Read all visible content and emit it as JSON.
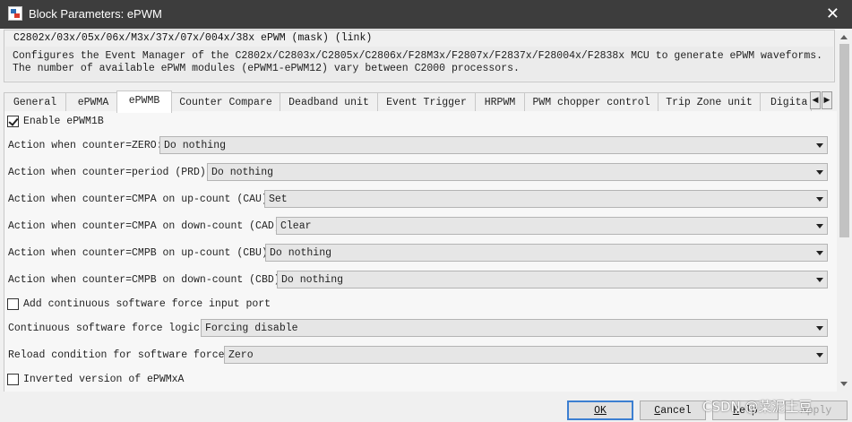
{
  "window": {
    "title": "Block Parameters: ePWM",
    "close_glyph": "✕"
  },
  "mask": {
    "title": "C2802x/03x/05x/06x/M3x/37x/07x/004x/38x ePWM (mask) (link)",
    "description_line1": "Configures the Event Manager of the C2802x/C2803x/C2805x/C2806x/F28M3x/F2807x/F2837x/F28004x/F2838x MCU to generate ePWM waveforms.",
    "description_line2": "The number of available ePWM modules (ePWM1-ePWM12) vary between C2000 processors."
  },
  "tabs": [
    {
      "label": "General"
    },
    {
      "label": "ePWMA"
    },
    {
      "label": "ePWMB",
      "active": true
    },
    {
      "label": "Counter Compare"
    },
    {
      "label": "Deadband unit"
    },
    {
      "label": "Event Trigger"
    },
    {
      "label": "HRPWM"
    },
    {
      "label": "PWM chopper control"
    },
    {
      "label": "Trip Zone unit"
    },
    {
      "label": "Digita"
    }
  ],
  "tab_scroll": {
    "left": "◀",
    "right": "▶"
  },
  "params": {
    "enable_epwm1b": {
      "label": "Enable ePWM1B",
      "checked": true
    },
    "action_zero": {
      "label": "Action when counter=ZERO:",
      "value": "Do nothing"
    },
    "action_prd": {
      "label": "Action when counter=period (PRD):",
      "value": "Do nothing"
    },
    "action_cau": {
      "label": "Action when counter=CMPA on up-count (CAU):",
      "value": "Set"
    },
    "action_cad": {
      "label": "Action when counter=CMPA on down-count (CAD):",
      "value": "Clear"
    },
    "action_cbu": {
      "label": "Action when counter=CMPB on up-count (CBU):",
      "value": "Do nothing"
    },
    "action_cbd": {
      "label": "Action when counter=CMPB on down-count (CBD):",
      "value": "Do nothing"
    },
    "add_sw_force": {
      "label": "Add continuous software force input port",
      "checked": false
    },
    "sw_force_logic": {
      "label": "Continuous software force logic:",
      "value": "Forcing disable"
    },
    "reload_condition": {
      "label": "Reload condition for software force:",
      "value": "Zero"
    },
    "inverted_epwmxa": {
      "label": "Inverted version of ePWMxA",
      "checked": false
    }
  },
  "buttons": {
    "ok": "OK",
    "cancel_first": "C",
    "cancel_rest": "ancel",
    "help_first": "H",
    "help_rest": "elp",
    "apply": "Apply"
  },
  "watermark": "CSDN @菜泥土豆"
}
